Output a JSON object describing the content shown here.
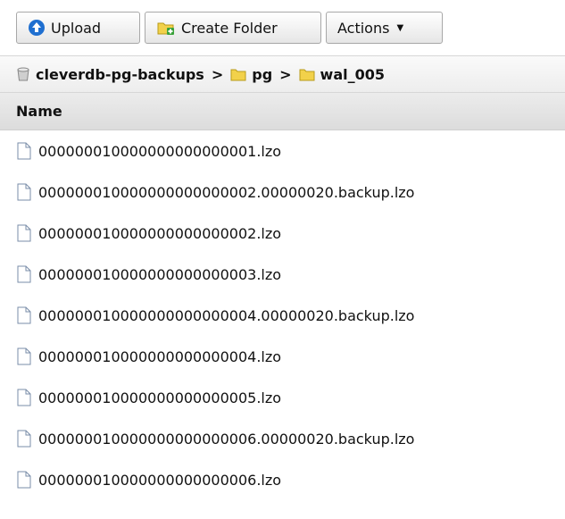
{
  "toolbar": {
    "upload_label": "Upload",
    "create_folder_label": "Create Folder",
    "actions_label": "Actions"
  },
  "breadcrumb": {
    "bucket": "cleverdb-pg-backups",
    "separator": ">",
    "folders": [
      "pg",
      "wal_005"
    ]
  },
  "table": {
    "column_header": "Name",
    "rows": [
      "000000010000000000000001.lzo",
      "000000010000000000000002.00000020.backup.lzo",
      "000000010000000000000002.lzo",
      "000000010000000000000003.lzo",
      "000000010000000000000004.00000020.backup.lzo",
      "000000010000000000000004.lzo",
      "000000010000000000000005.lzo",
      "000000010000000000000006.00000020.backup.lzo",
      "000000010000000000000006.lzo"
    ]
  },
  "colors": {
    "upload_icon": "#1f6fd0",
    "folder_icon": "#f2d14a",
    "folder_plus": "#3aa23a"
  }
}
